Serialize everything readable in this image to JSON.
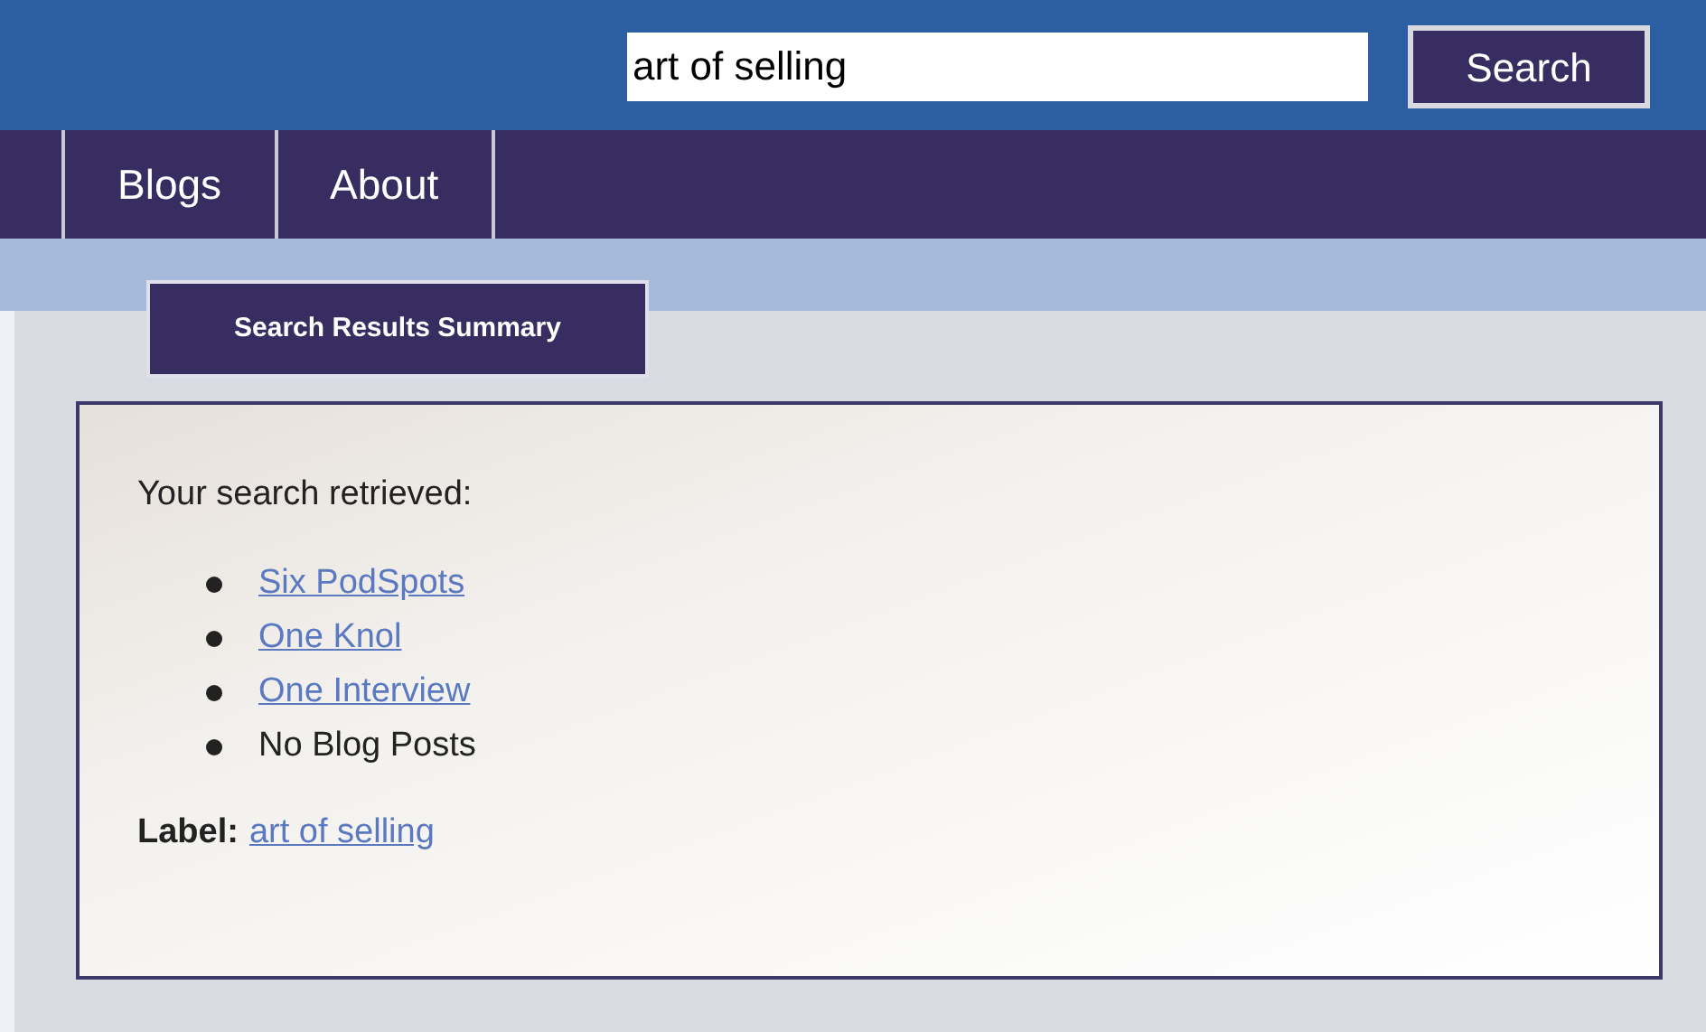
{
  "search": {
    "value": "art of selling",
    "button": "Search"
  },
  "nav": [
    {
      "label": "Blogs"
    },
    {
      "label": "About"
    }
  ],
  "tab": {
    "label": "Search Results Summary"
  },
  "summary": {
    "intro": "Your search retrieved:",
    "items": [
      {
        "kind": "link",
        "text": "Six PodSpots"
      },
      {
        "kind": "link",
        "text": "One Knol"
      },
      {
        "kind": "link",
        "text": "One Interview"
      },
      {
        "kind": "text",
        "text": "No Blog Posts"
      }
    ],
    "label_caption": "Label:",
    "label_link": "art of selling"
  }
}
